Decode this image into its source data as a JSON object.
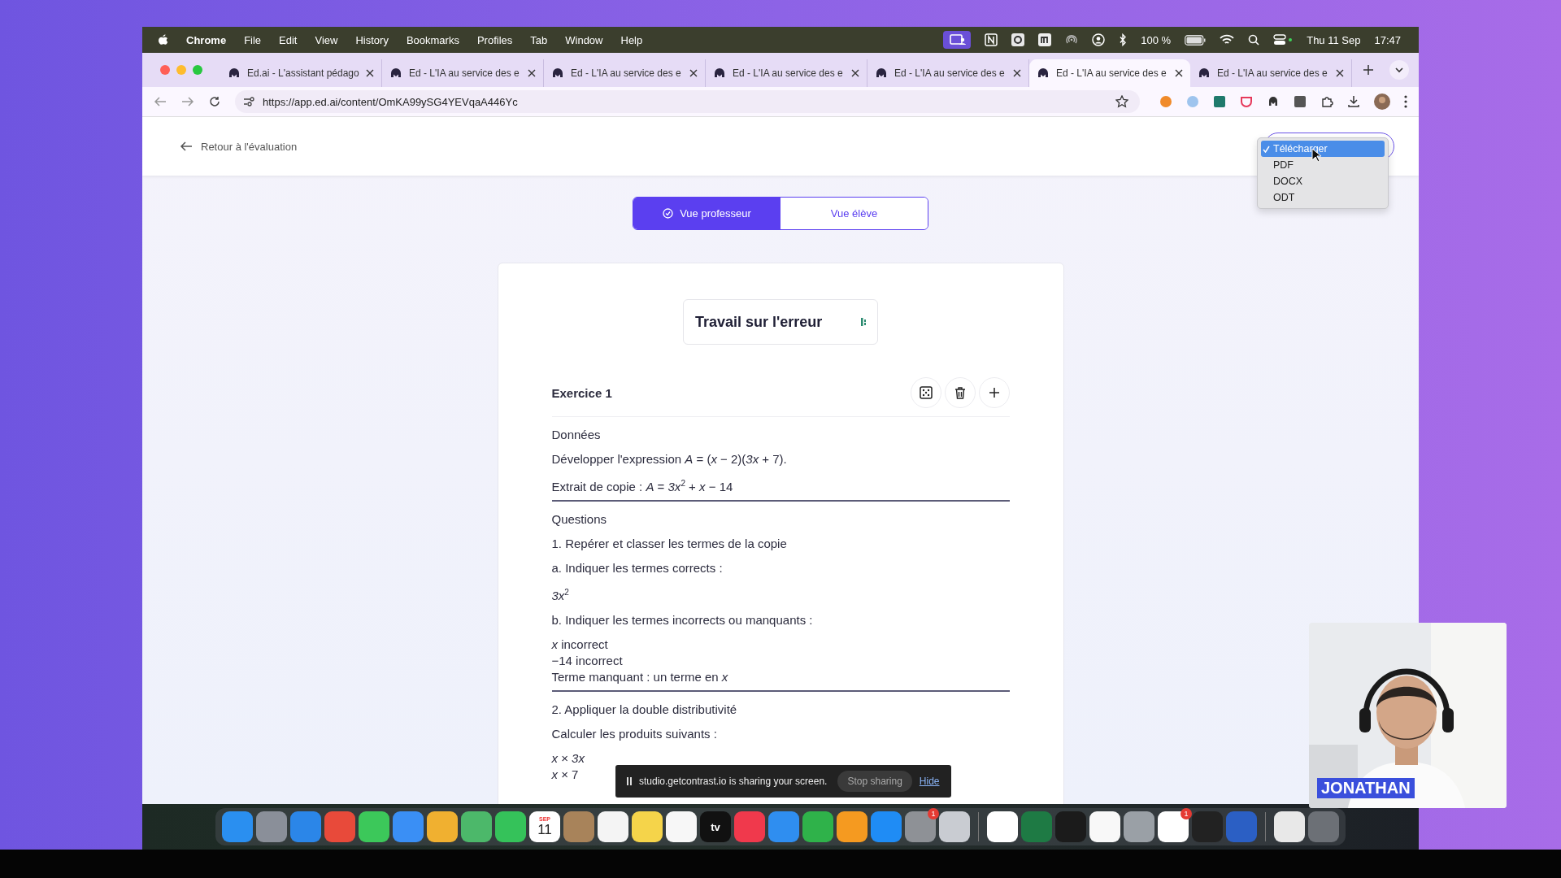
{
  "menu_bar": {
    "app": "Chrome",
    "menus": [
      "File",
      "Edit",
      "View",
      "History",
      "Bookmarks",
      "Profiles",
      "Tab",
      "Window",
      "Help"
    ],
    "battery": "100 %",
    "date": "Thu 11 Sep",
    "time": "17:47"
  },
  "tabs": [
    {
      "title": "Ed.ai - L'assistant pédago",
      "selected": false
    },
    {
      "title": "Ed - L'IA au service des e",
      "selected": false
    },
    {
      "title": "Ed - L'IA au service des e",
      "selected": false
    },
    {
      "title": "Ed - L'IA au service des e",
      "selected": false
    },
    {
      "title": "Ed - L'IA au service des e",
      "selected": false
    },
    {
      "title": "Ed - L'IA au service des e",
      "selected": true
    },
    {
      "title": "Ed - L'IA au service des e",
      "selected": false
    }
  ],
  "address_bar": {
    "url": "https://app.ed.ai/content/OmKA99ySG4YEVqaA446Yc"
  },
  "page": {
    "back_link": "Retour à l'évaluation",
    "download_menu": [
      {
        "label": "Télécharger",
        "selected": true
      },
      {
        "label": "PDF",
        "selected": false
      },
      {
        "label": "DOCX",
        "selected": false
      },
      {
        "label": "ODT",
        "selected": false
      }
    ],
    "view_toggle": [
      {
        "label": "Vue professeur",
        "selected": true
      },
      {
        "label": "Vue élève",
        "selected": false
      }
    ],
    "document": {
      "title": "Travail sur l'erreur",
      "exercise": "Exercice 1",
      "sections": [
        [
          {
            "text": "Données",
            "kind": "para"
          },
          {
            "text": "Développer l'expression *A* = (*x* − 2)(*3x* + 7).",
            "kind": "para"
          },
          {
            "text": "Extrait de copie : *A* = *3x*$^{2}$ + *x* − 14",
            "kind": "para"
          }
        ],
        [
          {
            "text": "Questions",
            "kind": "para"
          },
          {
            "text": "1. Repérer et classer les termes de la copie",
            "kind": "para"
          },
          {
            "text": "a. Indiquer les termes corrects :",
            "kind": "para"
          },
          {
            "text": "*3x*$^{2}$",
            "kind": "para"
          },
          {
            "text": "b. Indiquer les termes incorrects ou manquants :",
            "kind": "para"
          },
          {
            "text": "*x* incorrect",
            "kind": "para"
          },
          {
            "text": "−14 incorrect",
            "kind": "tight"
          },
          {
            "text": "Terme manquant : un terme en *x*",
            "kind": "tight"
          }
        ],
        [
          {
            "text": "2. Appliquer la double distributivité",
            "kind": "para"
          },
          {
            "text": "Calculer les produits suivants :",
            "kind": "para"
          },
          {
            "text": "*x* × *3x*",
            "kind": "para"
          },
          {
            "text": "*x* × 7",
            "kind": "tight"
          }
        ]
      ]
    }
  },
  "screen_share_bar": {
    "message": "studio.getcontrast.io is sharing your screen.",
    "stop": "Stop sharing",
    "hide": "Hide"
  },
  "webcam": {
    "kind": "picture",
    "name_label": "JONATHAN"
  },
  "dock": [
    {
      "kind": "app",
      "color": "#2a8ff0"
    },
    {
      "kind": "app",
      "color": "#8a8f99"
    },
    {
      "kind": "app",
      "color": "#2b86e8"
    },
    {
      "kind": "app",
      "color": "#e84a3a"
    },
    {
      "kind": "app",
      "color": "#3cc85a"
    },
    {
      "kind": "app",
      "color": "#3a8ff5"
    },
    {
      "kind": "app",
      "color": "#f0b030"
    },
    {
      "kind": "app",
      "color": "#4cb86a"
    },
    {
      "kind": "app",
      "color": "#35c25a"
    },
    {
      "kind": "calendar",
      "color": "#ffffff",
      "month": "SEP",
      "day": "11"
    },
    {
      "kind": "app",
      "color": "#a8835a"
    },
    {
      "kind": "app",
      "color": "#f4f4f4"
    },
    {
      "kind": "app",
      "color": "#f5d44a"
    },
    {
      "kind": "app",
      "color": "#f7f7f7"
    },
    {
      "kind": "app",
      "color": "#111111",
      "label": "tv"
    },
    {
      "kind": "app",
      "color": "#f0394c"
    },
    {
      "kind": "app",
      "color": "#2f8ef0"
    },
    {
      "kind": "app",
      "color": "#2fb24a"
    },
    {
      "kind": "app",
      "color": "#f59a20"
    },
    {
      "kind": "app",
      "color": "#1f8cf5"
    },
    {
      "kind": "app",
      "color": "#8e9196",
      "badge": "1"
    },
    {
      "kind": "app",
      "color": "#c9ccd2"
    },
    {
      "kind": "separator"
    },
    {
      "kind": "app",
      "color": "#ffffff"
    },
    {
      "kind": "app",
      "color": "#1e7a44"
    },
    {
      "kind": "app",
      "color": "#1b1b1b"
    },
    {
      "kind": "app",
      "color": "#f8f8f8"
    },
    {
      "kind": "app",
      "color": "#9aa0a6"
    },
    {
      "kind": "app",
      "color": "#ffffff",
      "badge": "1"
    },
    {
      "kind": "app",
      "color": "#222222"
    },
    {
      "kind": "app",
      "color": "#2b5fc4"
    },
    {
      "kind": "separator"
    },
    {
      "kind": "app",
      "color": "#e8e8e8"
    },
    {
      "kind": "app",
      "color": "#6c7076"
    }
  ]
}
